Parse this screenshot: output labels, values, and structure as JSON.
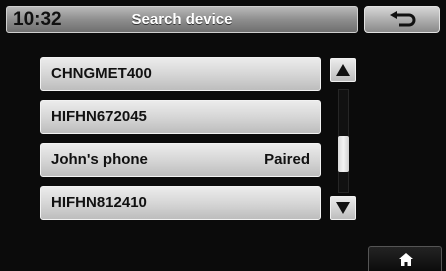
{
  "header": {
    "time": "10:32",
    "title": "Search device"
  },
  "devices": [
    {
      "name": "CHNGMET400",
      "status": ""
    },
    {
      "name": "HIFHN672045",
      "status": ""
    },
    {
      "name": "John's phone",
      "status": "Paired"
    },
    {
      "name": "HIFHN812410",
      "status": ""
    }
  ],
  "icons": {
    "back": "back-arrow-icon",
    "scroll_up": "triangle-up-icon",
    "scroll_down": "triangle-down-icon",
    "home": "home-icon"
  }
}
